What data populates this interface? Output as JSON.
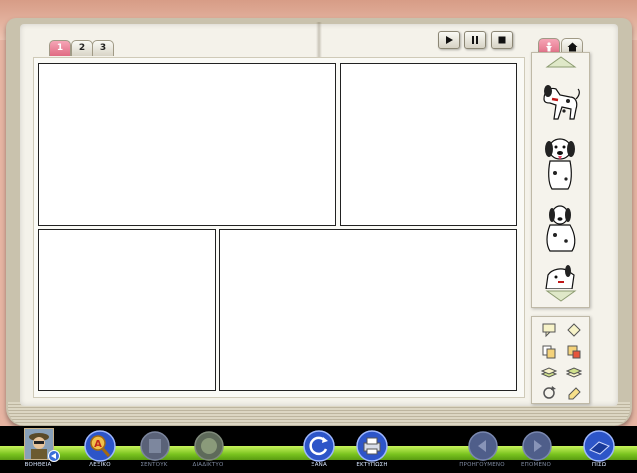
{
  "page_tabs": [
    {
      "label": "1",
      "active": true
    },
    {
      "label": "2",
      "active": false
    },
    {
      "label": "3",
      "active": false
    }
  ],
  "playback": {
    "play_icon": "play-icon",
    "pause_icon": "pause-icon",
    "stop_icon": "stop-icon"
  },
  "side_tabs": [
    {
      "icon": "character-icon",
      "active": true
    },
    {
      "icon": "home-icon",
      "active": false
    }
  ],
  "sticker_panel": {
    "stickers": [
      "dog-walking",
      "dog-sitting-front",
      "dog-sitting",
      "dog-peeking"
    ]
  },
  "tools": [
    "speech-bubble-tool",
    "shape-tool",
    "copy-tool",
    "duplicate-tool",
    "layer-down-tool",
    "layer-up-tool",
    "rotate-tool",
    "eraser-tool"
  ],
  "bottom_bar": {
    "help_label": "ΒΟΗΘΕΙΑ",
    "dictionary_label": "ΛΕΞΙΚΟ",
    "notebook_label": "ΣΕΝΤΟΥΚ",
    "internet_label": "ΔΙΑΔΙΚΤΥΟ",
    "again_label": "ΞΑΝΑ",
    "print_label": "ΕΚΤΥΠΩΣΗ",
    "previous_label": "ΠΡΟΗΓΟΥΜΕΝΟ",
    "next_label": "ΕΠΟΜΕΝΟ",
    "exit_label": "ΠΙΣΩ"
  },
  "colors": {
    "active_tab": "#e06b83",
    "accent_green": "#78c21e",
    "button_blue": "#2d55c8"
  }
}
